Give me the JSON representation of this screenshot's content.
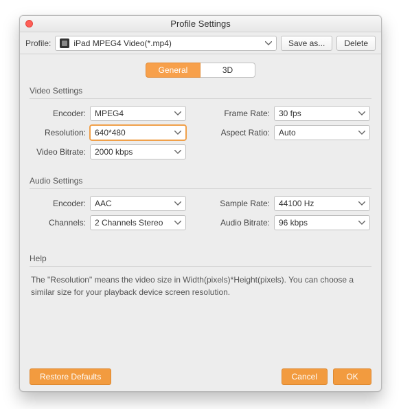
{
  "window": {
    "title": "Profile Settings"
  },
  "toolbar": {
    "profile_label": "Profile:",
    "profile_value": "iPad MPEG4 Video(*.mp4)",
    "save_as_label": "Save as...",
    "delete_label": "Delete"
  },
  "tabs": {
    "general": "General",
    "three_d": "3D",
    "active": "general"
  },
  "video": {
    "section_title": "Video Settings",
    "encoder_label": "Encoder:",
    "encoder_value": "MPEG4",
    "resolution_label": "Resolution:",
    "resolution_value": "640*480",
    "bitrate_label": "Video Bitrate:",
    "bitrate_value": "2000 kbps",
    "framerate_label": "Frame Rate:",
    "framerate_value": "30 fps",
    "aspect_label": "Aspect Ratio:",
    "aspect_value": "Auto"
  },
  "audio": {
    "section_title": "Audio Settings",
    "encoder_label": "Encoder:",
    "encoder_value": "AAC",
    "channels_label": "Channels:",
    "channels_value": "2 Channels Stereo",
    "samplerate_label": "Sample Rate:",
    "samplerate_value": "44100 Hz",
    "bitrate_label": "Audio Bitrate:",
    "bitrate_value": "96 kbps"
  },
  "help": {
    "section_title": "Help",
    "text": "The \"Resolution\" means the video size in Width(pixels)*Height(pixels).  You can choose a similar size for your playback device screen resolution."
  },
  "footer": {
    "restore_label": "Restore Defaults",
    "cancel_label": "Cancel",
    "ok_label": "OK"
  },
  "colors": {
    "accent": "#f29b3f"
  }
}
